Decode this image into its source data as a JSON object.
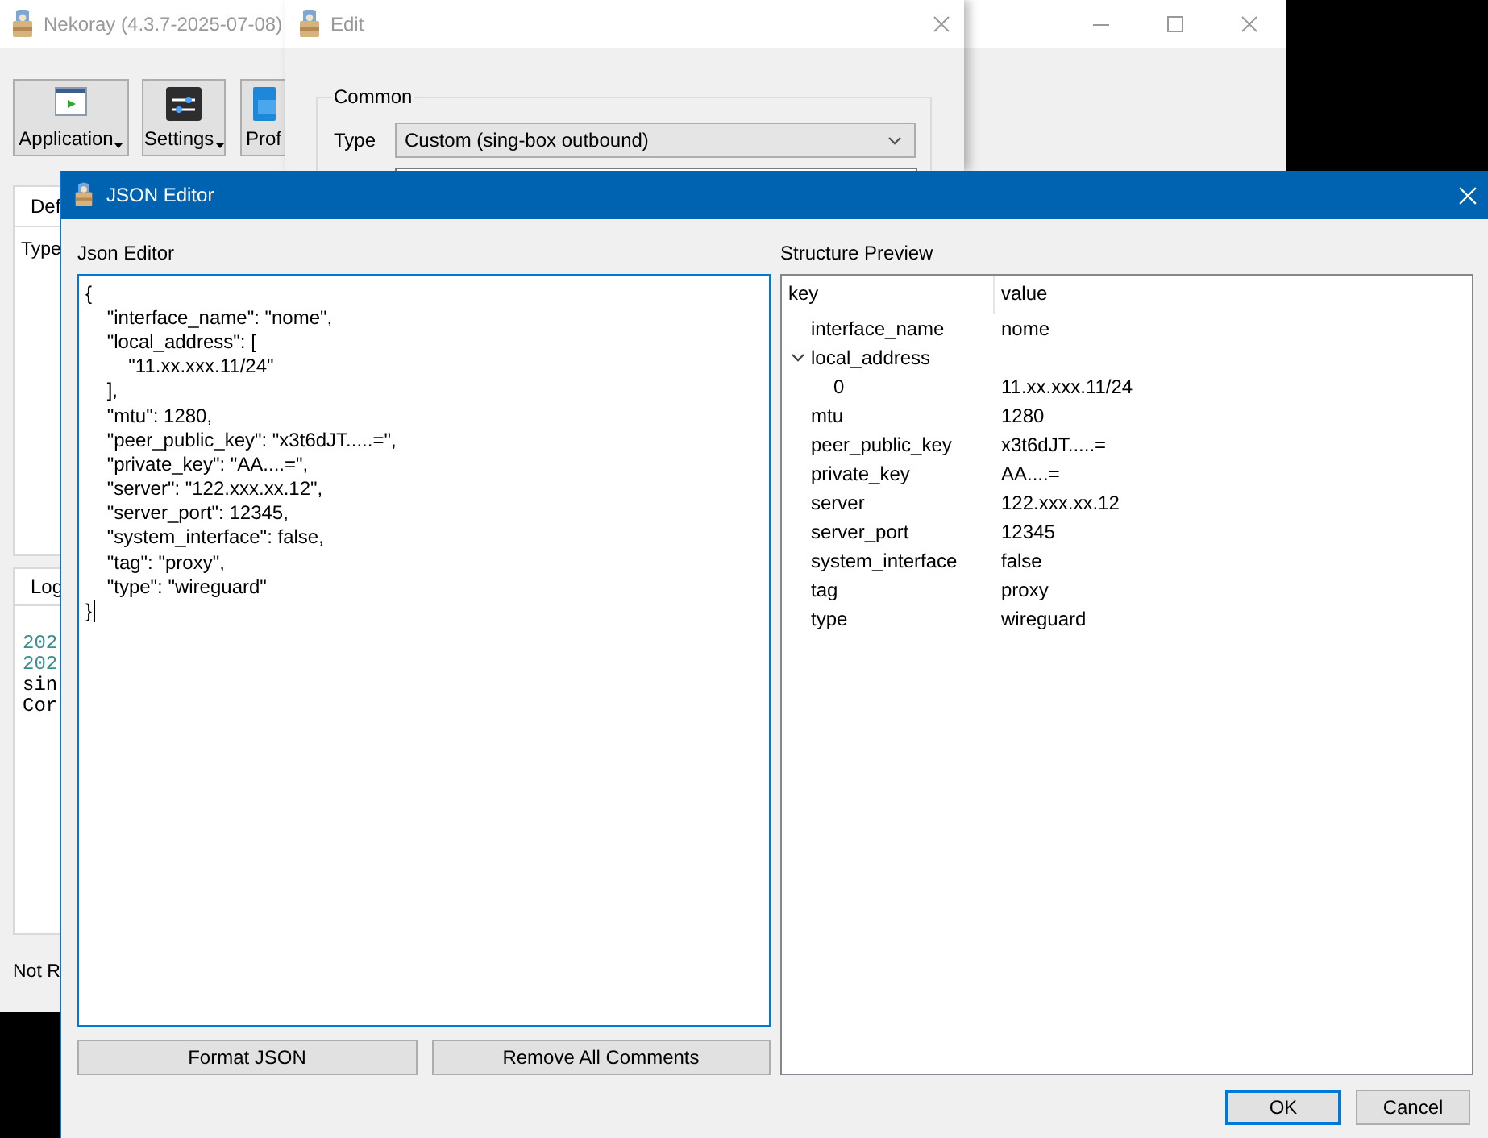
{
  "main_window": {
    "title": "Nekoray (4.3.7-2025-07-08)",
    "toolbar": [
      {
        "label": "Application",
        "kind": "application",
        "dropdown": true
      },
      {
        "label": "Settings",
        "kind": "settings",
        "dropdown": true
      },
      {
        "label": "Prof",
        "kind": "folder",
        "dropdown": false
      }
    ],
    "top_tab": "Def",
    "top_panel_label": "Type",
    "log_tab": "Log",
    "log_lines": [
      {
        "text": "202",
        "color": "#3a8f8f"
      },
      {
        "text": "202",
        "color": "#3a8f8f"
      },
      {
        "text": "sin",
        "color": "#000000"
      },
      {
        "text": "Cor",
        "color": "#000000"
      }
    ],
    "status": "Not R"
  },
  "edit_window": {
    "title": "Edit",
    "group_title": "Common",
    "type_label": "Type",
    "type_value": "Custom (sing-box outbound)"
  },
  "json_editor_dialog": {
    "title": "JSON Editor",
    "editor_label": "Json Editor",
    "editor": {
      "value": "{\n    \"interface_name\": \"nome\",\n    \"local_address\": [\n        \"11.xx.xxx.11/24\"\n    ],\n    \"mtu\": 1280,\n    \"peer_public_key\": \"x3t6dJT.....=\",\n    \"private_key\": \"AA....=\",\n    \"server\": \"122.xxx.xx.12\",\n    \"server_port\": 12345,\n    \"system_interface\": false,\n    \"tag\": \"proxy\",\n    \"type\": \"wireguard\"\n}",
      "focused": true
    },
    "editor_buttons": [
      {
        "label": "Format JSON"
      },
      {
        "label": "Remove All Comments"
      }
    ],
    "preview_label": "Structure Preview",
    "preview": {
      "columns": [
        "key",
        "value"
      ],
      "rows": [
        {
          "key": "interface_name",
          "value": "nome"
        },
        {
          "key": "local_address",
          "expanded": true,
          "children": [
            {
              "key": "0",
              "value": "11.xx.xxx.11/24"
            }
          ]
        },
        {
          "key": "mtu",
          "value": "1280"
        },
        {
          "key": "peer_public_key",
          "value": "x3t6dJT.....="
        },
        {
          "key": "private_key",
          "value": "AA....="
        },
        {
          "key": "server",
          "value": "122.xxx.xx.12"
        },
        {
          "key": "server_port",
          "value": "12345"
        },
        {
          "key": "system_interface",
          "value": "false"
        },
        {
          "key": "tag",
          "value": "proxy"
        },
        {
          "key": "type",
          "value": "wireguard"
        }
      ]
    },
    "buttons": [
      {
        "label": "OK",
        "default": true
      },
      {
        "label": "Cancel",
        "default": false
      }
    ]
  }
}
